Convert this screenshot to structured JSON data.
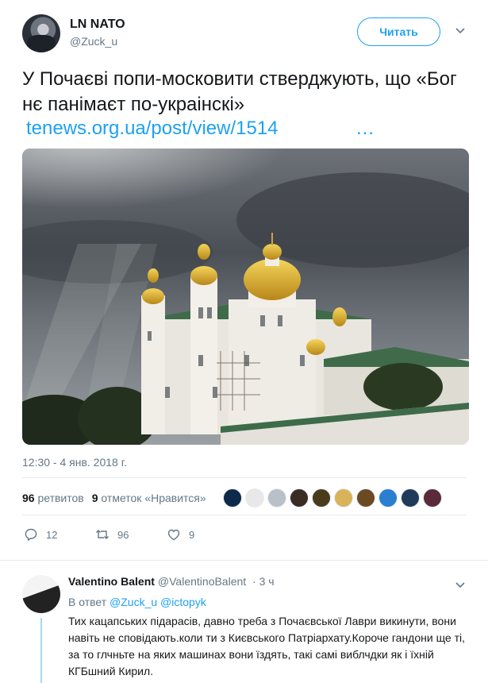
{
  "tweet": {
    "author_name": "LN NATO",
    "author_handle": "@Zuck_u",
    "follow_label": "Читать",
    "text": "У Почаєві попи-московити стверджують, що «Бог нє панімаєт по-украінскі»",
    "link": "tenews.org.ua/post/view/1514",
    "link_ellipsis": "…",
    "timestamp": "12:30 - 4 янв. 2018 г.",
    "stats": {
      "retweets_count": "96",
      "retweets_label": "ретвитов",
      "likes_count": "9",
      "likes_label": "отметок «Нравится»"
    },
    "actions": {
      "reply_count": "12",
      "retweet_count": "96",
      "like_count": "9"
    },
    "liker_colors": [
      "#0e2a4a",
      "#e8e8e8",
      "#b9c0c8",
      "#3a2b25",
      "#4a3b1a",
      "#d9b35a",
      "#6b4a22",
      "#2a7fd0",
      "#1f3a5a",
      "#5a2a3a"
    ]
  },
  "reply": {
    "author_name": "Valentino Balent",
    "author_handle": "@ValentinoBalent",
    "time": "· 3 ч",
    "in_reply_prefix": "В ответ",
    "mention_1": "@Zuck_u",
    "mention_2": "@ictopyk",
    "body": "Тих кацапських підарасів, давно треба з Почаєвської Лаври викинути, вони навіть не сповідають.коли ти з Києвського Патріархату.Короче гандони ще ті, за то глчньте на яких машинах вони їздять, такі самі виблчдки як і їхній КГБшний Кирил."
  }
}
